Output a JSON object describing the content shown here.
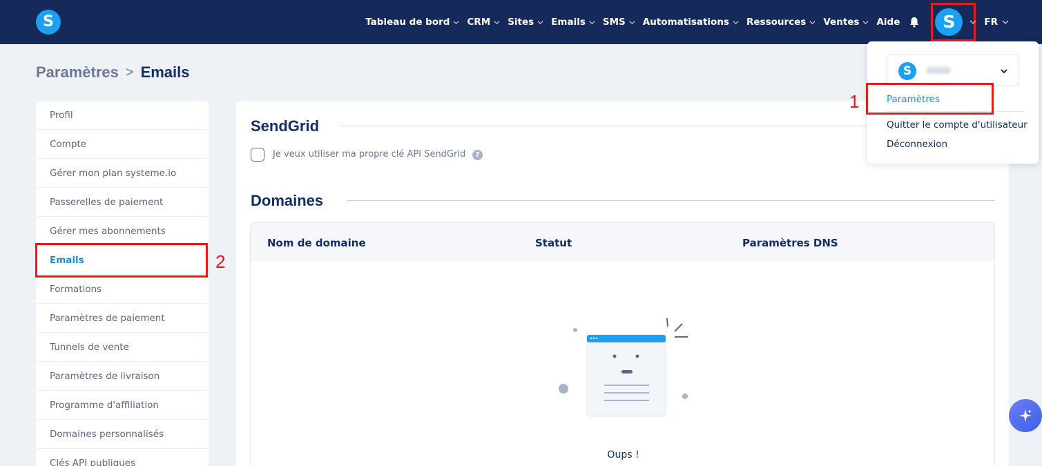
{
  "app": {
    "logo_letter": "S"
  },
  "nav": {
    "items": [
      {
        "label": "Tableau de bord",
        "has_chevron": true
      },
      {
        "label": "CRM",
        "has_chevron": true
      },
      {
        "label": "Sites",
        "has_chevron": true
      },
      {
        "label": "Emails",
        "has_chevron": true
      },
      {
        "label": "SMS",
        "has_chevron": true
      },
      {
        "label": "Automatisations",
        "has_chevron": true
      },
      {
        "label": "Ressources",
        "has_chevron": true
      },
      {
        "label": "Ventes",
        "has_chevron": true
      },
      {
        "label": "Aide",
        "has_chevron": false
      }
    ],
    "notification_icon": "bell-icon",
    "avatar_letter": "S",
    "language": "FR"
  },
  "breadcrumb": {
    "parent": "Paramètres",
    "separator": ">",
    "current": "Emails"
  },
  "sidebar": {
    "items": [
      {
        "label": "Profil",
        "active": false
      },
      {
        "label": "Compte",
        "active": false
      },
      {
        "label": "Gérer mon plan systeme.io",
        "active": false
      },
      {
        "label": "Passerelles de paiement",
        "active": false
      },
      {
        "label": "Gérer mes abonnements",
        "active": false
      },
      {
        "label": "Emails",
        "active": true
      },
      {
        "label": "Formations",
        "active": false
      },
      {
        "label": "Paramètres de paiement",
        "active": false
      },
      {
        "label": "Tunnels de vente",
        "active": false
      },
      {
        "label": "Paramètres de livraison",
        "active": false
      },
      {
        "label": "Programme d'affiliation",
        "active": false
      },
      {
        "label": "Domaines personnalisés",
        "active": false
      },
      {
        "label": "Clés API publiques",
        "active": false
      }
    ]
  },
  "main": {
    "sendgrid": {
      "title": "SendGrid",
      "checkbox_label": "Je veux utiliser ma propre clé API SendGrid",
      "checked": false,
      "help_icon": "?"
    },
    "domains": {
      "title": "Domaines",
      "columns": [
        "Nom de domaine",
        "Statut",
        "Paramètres DNS"
      ],
      "empty_message": "Oups !"
    }
  },
  "dropdown": {
    "account_avatar_letter": "S",
    "items": [
      {
        "label": "Paramètres",
        "active": true
      },
      {
        "label": "Quitter le compte d'utilisateur",
        "active": false
      },
      {
        "label": "Déconnexion",
        "active": false
      }
    ]
  },
  "annotations": {
    "step1": "1",
    "step2": "2"
  },
  "colors": {
    "nav_bg": "#15295a",
    "brand": "#1ba0f2",
    "accent": "#1b8be0",
    "highlight": "#e61b1b"
  }
}
